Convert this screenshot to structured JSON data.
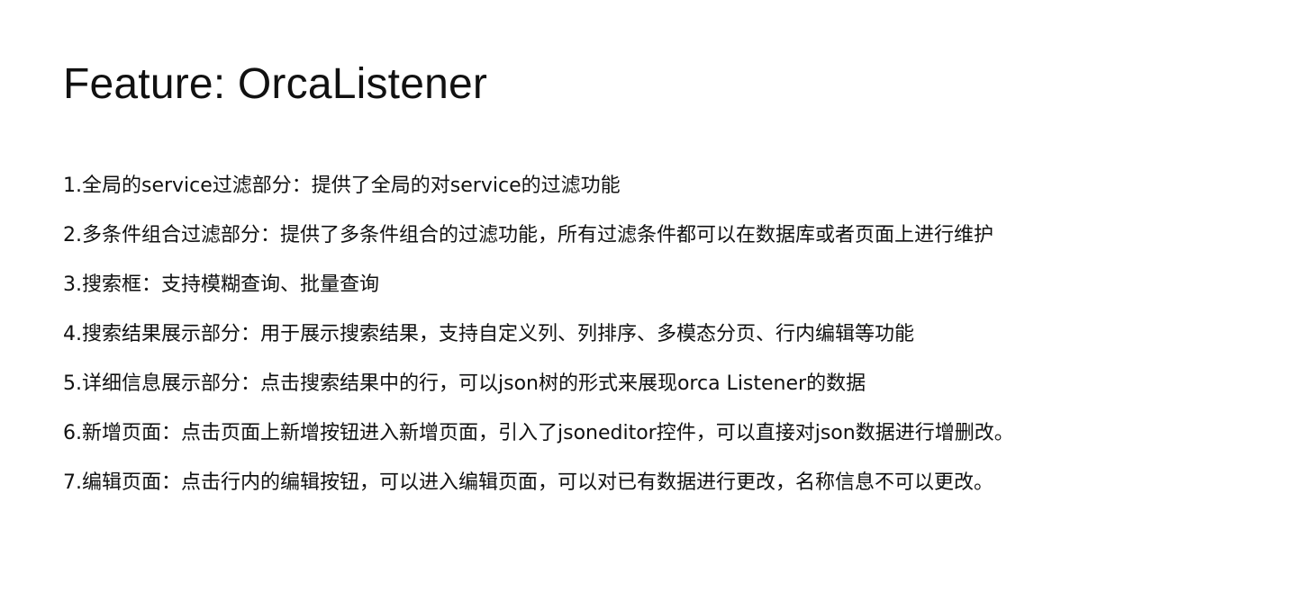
{
  "document": {
    "title": "Feature: OrcaListener",
    "items": [
      "1.全局的service过滤部分：提供了全局的对service的过滤功能",
      "2.多条件组合过滤部分：提供了多条件组合的过滤功能，所有过滤条件都可以在数据库或者页面上进行维护",
      "3.搜索框：支持模糊查询、批量查询",
      "4.搜索结果展示部分：用于展示搜索结果，支持自定义列、列排序、多模态分页、行内编辑等功能",
      "5.详细信息展示部分：点击搜索结果中的行，可以json树的形式来展现orca Listener的数据",
      "6.新增页面：点击页面上新增按钮进入新增页面，引入了jsoneditor控件，可以直接对json数据进行增删改。",
      "7.编辑页面：点击行内的编辑按钮，可以进入编辑页面，可以对已有数据进行更改，名称信息不可以更改。"
    ]
  }
}
